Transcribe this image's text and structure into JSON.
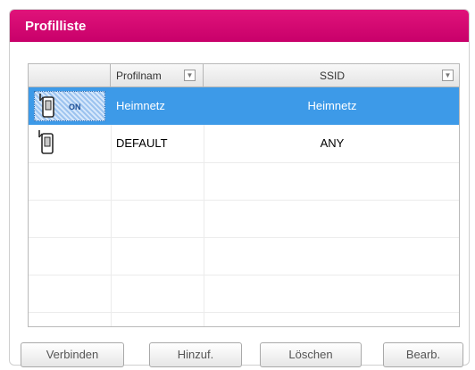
{
  "panel": {
    "title": "Profilliste"
  },
  "table": {
    "headers": {
      "profile_name": "Profilnam",
      "ssid": "SSID"
    },
    "rows": [
      {
        "name": "Heimnetz",
        "ssid": "Heimnetz",
        "selected": true,
        "icon": "wifi-profile-icon",
        "badge": "ON"
      },
      {
        "name": "DEFAULT",
        "ssid": "ANY",
        "selected": false,
        "icon": "wifi-profile-icon"
      }
    ]
  },
  "buttons": {
    "connect": "Verbinden",
    "add": "Hinzuf.",
    "delete": "Löschen",
    "edit": "Bearb."
  },
  "colors": {
    "title_bar": "#d6006f",
    "selection": "#3d9ae8"
  }
}
